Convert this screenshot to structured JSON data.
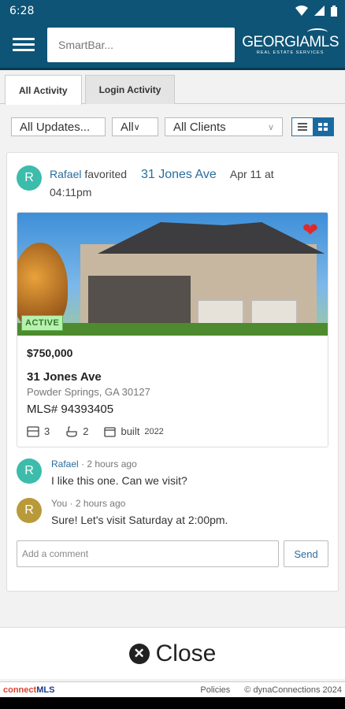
{
  "status_bar": {
    "time": "6:28"
  },
  "header": {
    "smartbar_placeholder": "SmartBar...",
    "logo": {
      "brand": "GEORGIA",
      "brand_suffix": "MLS",
      "tagline": "REAL ESTATE SERVICES"
    }
  },
  "tabs": [
    {
      "label": "All Activity",
      "active": true
    },
    {
      "label": "Login Activity",
      "active": false
    }
  ],
  "filters": {
    "updates": "All Updates...",
    "scope": "All",
    "clients": "All Clients"
  },
  "activity": {
    "avatar_initial": "R",
    "user": "Rafael",
    "action": "favorited",
    "address_link": "31 Jones Ave",
    "date": "Apr 11 at",
    "time": "04:11pm"
  },
  "listing": {
    "status": "ACTIVE",
    "price": "$750,000",
    "address": "31 Jones Ave",
    "city": "Powder Springs, GA 30127",
    "mls": "MLS# 94393405",
    "beds": "3",
    "baths": "2",
    "built_label": "built",
    "built_year": "2022"
  },
  "comments": [
    {
      "initial": "R",
      "author": "Rafael",
      "time": "· 2 hours ago",
      "text": "I like this one. Can we visit?"
    },
    {
      "initial": "R",
      "author": "You",
      "time": "· 2 hours ago",
      "text": "Sure! Let's visit Saturday at 2:00pm."
    }
  ],
  "comment_box": {
    "placeholder": "Add a comment",
    "send_label": "Send"
  },
  "close_label": "Close",
  "footer": {
    "brand_a": "connect",
    "brand_b": "MLS",
    "policies": "Policies",
    "copyright": "© dynaConnections 2024"
  },
  "colors": {
    "header": "#0e5476",
    "accent": "#2a6d9e",
    "favorite": "#e02a2a",
    "active_badge": "#b8f0b0"
  }
}
